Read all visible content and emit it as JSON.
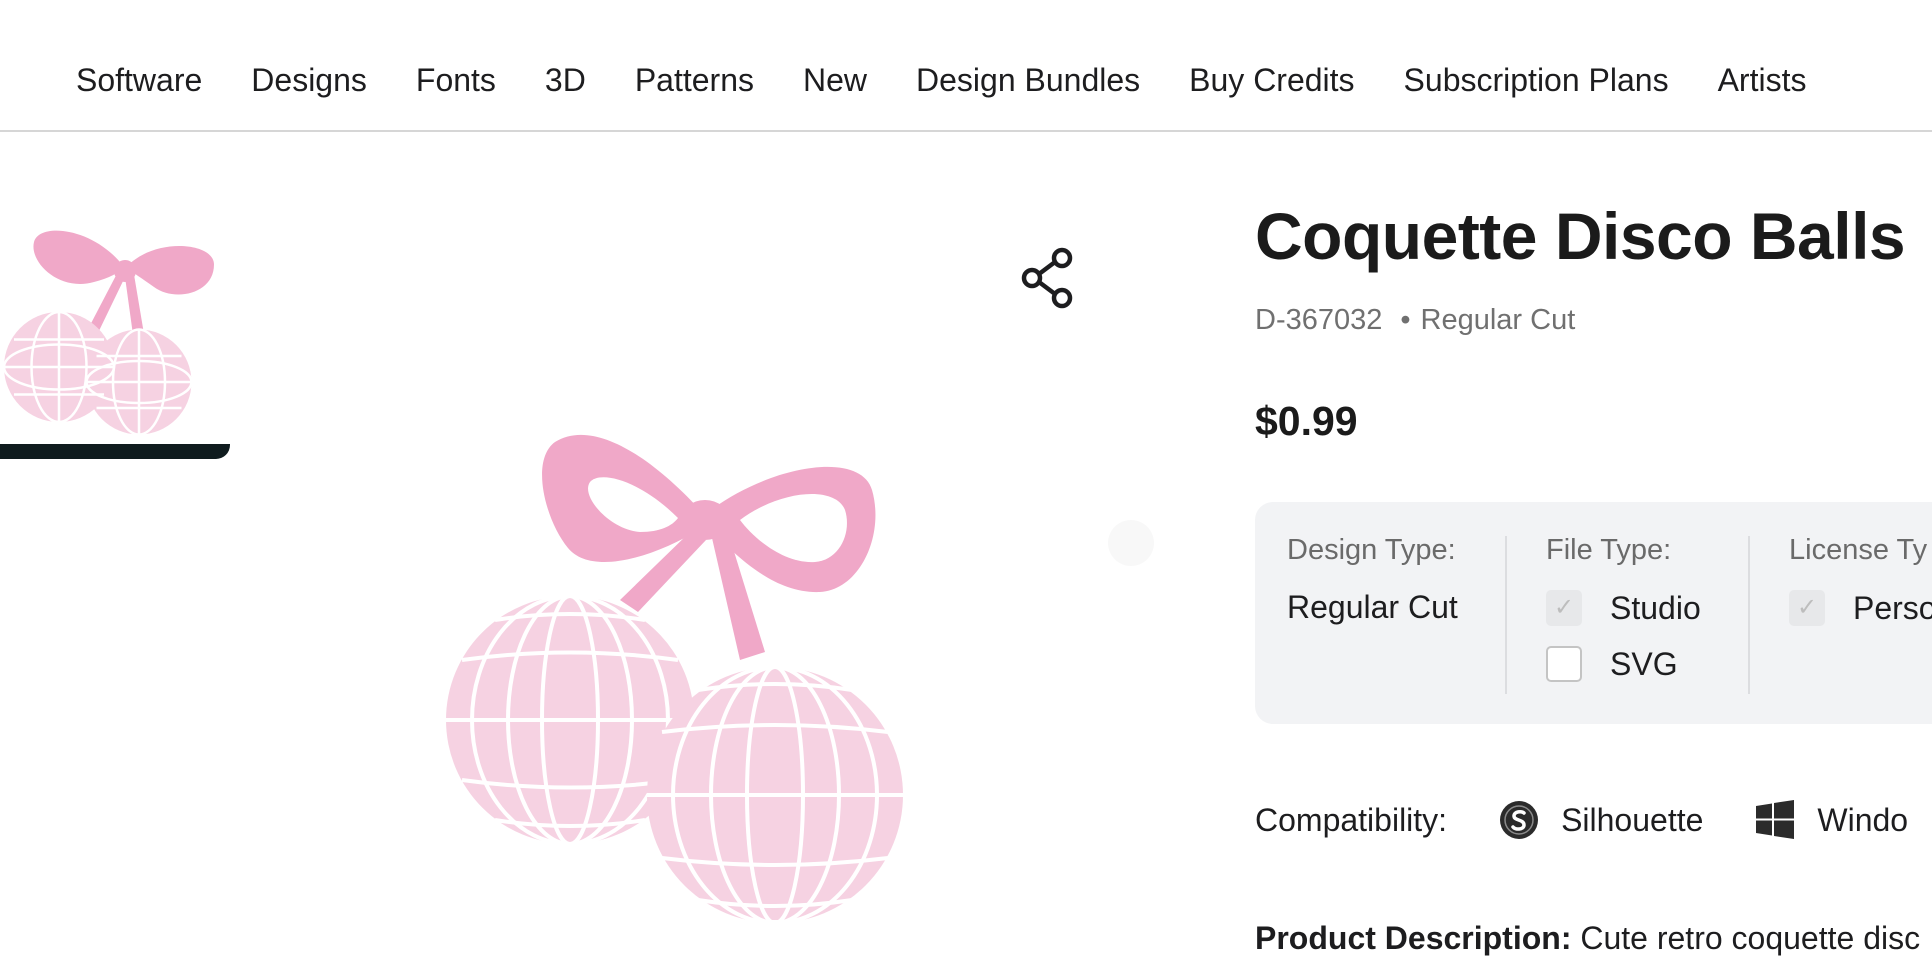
{
  "nav": {
    "items": [
      "Software",
      "Designs",
      "Fonts",
      "3D",
      "Patterns",
      "New",
      "Design Bundles",
      "Buy Credits",
      "Subscription Plans",
      "Artists"
    ]
  },
  "product": {
    "title": "Coquette Disco Balls",
    "id": "D-367032",
    "cut_type": "Regular Cut",
    "price": "$0.99"
  },
  "options": {
    "design_type_label": "Design Type:",
    "design_type_value": "Regular Cut",
    "file_type_label": "File Type:",
    "file_types": [
      {
        "label": "Studio",
        "checked": true
      },
      {
        "label": "SVG",
        "checked": false
      }
    ],
    "license_label": "License Ty",
    "license_value": "Perso",
    "license_checked": true
  },
  "compatibility": {
    "label": "Compatibility:",
    "items": [
      {
        "label": "Silhouette",
        "icon": "silhouette-logo-icon"
      },
      {
        "label": "Windo",
        "icon": "windows-logo-icon"
      }
    ]
  },
  "description": {
    "label": "Product Description:",
    "text": "Cute retro coquette disc"
  },
  "colors": {
    "ribbon": "#f0a8c8",
    "ball": "#f6d2e2",
    "panel": "#f2f3f5",
    "accent_dark": "#0f1b1e"
  },
  "icons": [
    "share-icon",
    "silhouette-logo-icon",
    "windows-logo-icon",
    "checkbox-check-icon"
  ]
}
